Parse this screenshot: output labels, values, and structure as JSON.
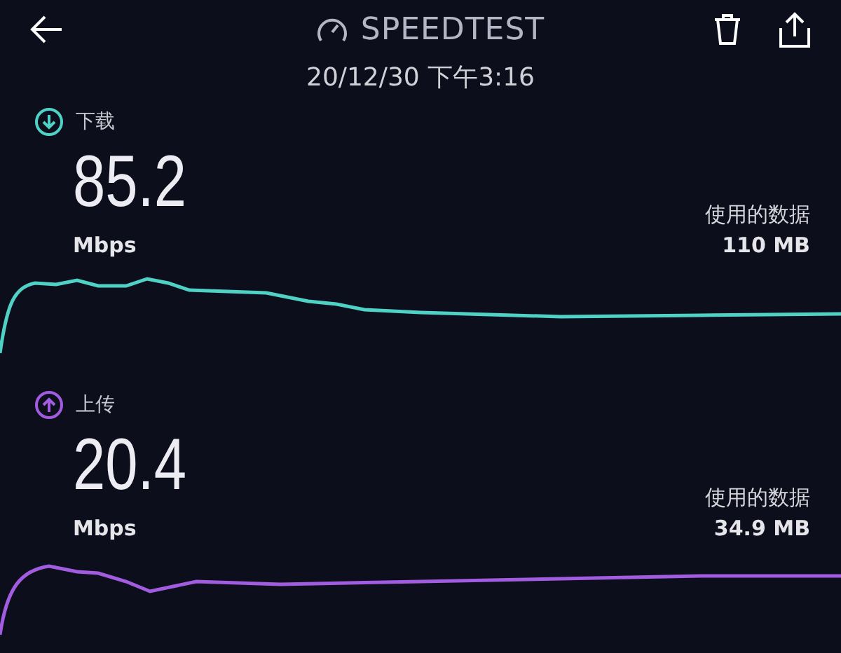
{
  "header": {
    "title": "SPEEDTEST",
    "timestamp": "20/12/30 下午3:16"
  },
  "results": [
    {
      "kind": "download",
      "label": "下载",
      "color": "#4fd1c5",
      "value": "85.2",
      "unit": "Mbps",
      "data_label": "使用的数据",
      "data_value": "110 MB"
    },
    {
      "kind": "upload",
      "label": "上传",
      "color": "#a15ce0",
      "value": "20.4",
      "unit": "Mbps",
      "data_label": "使用的数据",
      "data_value": "34.9 MB"
    }
  ]
}
